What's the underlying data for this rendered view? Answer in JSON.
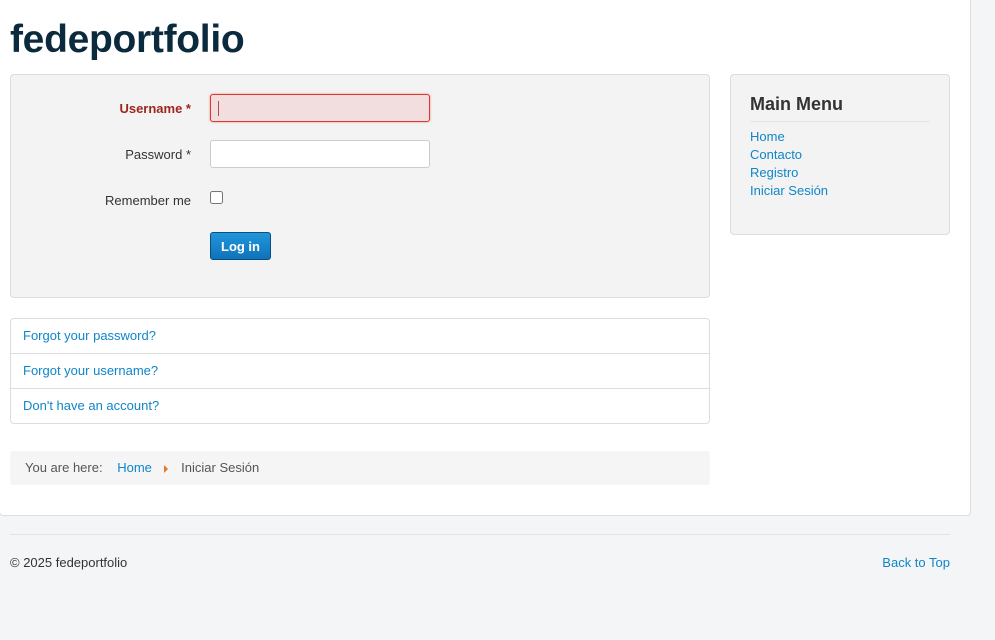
{
  "site": {
    "title": "fedeportfolio"
  },
  "login_form": {
    "username_label": "Username *",
    "username_value": "",
    "password_label": "Password *",
    "password_value": "",
    "remember_label": "Remember me",
    "remember_checked": false,
    "submit_label": "Log in",
    "colors": {
      "invalid_label": "#9d261d",
      "invalid_field_bg": "#f2dede",
      "invalid_field_border": "#e0352b",
      "button_bg": "#1d8ad4"
    }
  },
  "help_links": [
    {
      "label": "Forgot your password?"
    },
    {
      "label": "Forgot your username?"
    },
    {
      "label": "Don't have an account?"
    }
  ],
  "breadcrumb": {
    "prefix": "You are here:",
    "items": [
      {
        "label": "Home",
        "link": true
      },
      {
        "label": "Iniciar Sesión",
        "link": false
      }
    ],
    "separator_icon": "triangle-right-icon",
    "separator_color": "#e5772c"
  },
  "sidebar": {
    "title": "Main Menu",
    "items": [
      {
        "label": "Home"
      },
      {
        "label": "Contacto"
      },
      {
        "label": "Registro"
      },
      {
        "label": "Iniciar Sesión"
      }
    ]
  },
  "footer": {
    "copyright": "© 2025 fedeportfolio",
    "back_to_top": "Back to Top"
  },
  "colors": {
    "link": "#0f86c8",
    "title": "#0b2a3d",
    "page_bg": "#f4f5f7",
    "card_bg": "#ffffff"
  }
}
